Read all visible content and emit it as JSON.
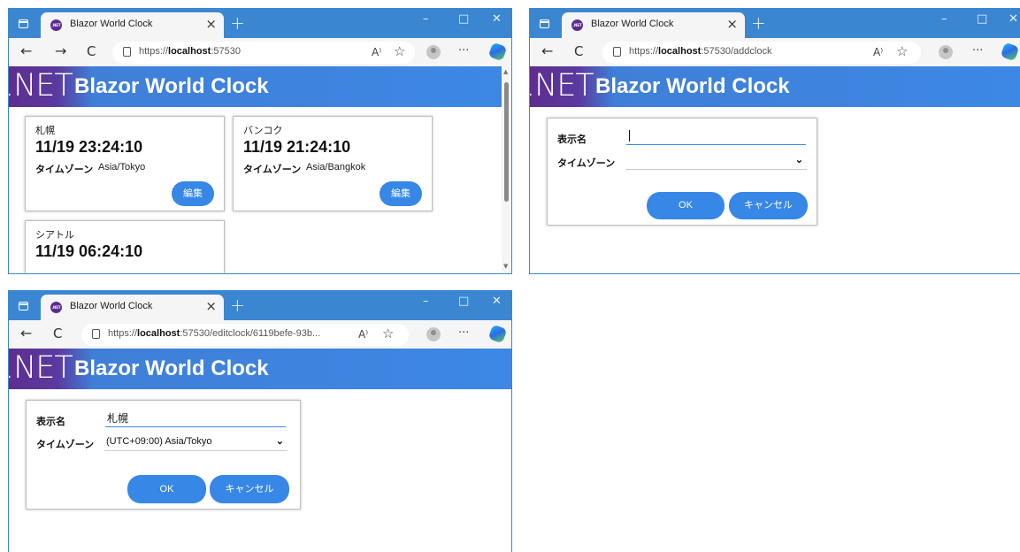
{
  "colors": {
    "accent": "#3d88e5",
    "brand_purple": "#5f2d90",
    "button": "#3687e6"
  },
  "browser": {
    "tab_title": "Blazor World Clock",
    "favicon_text": ".NET",
    "new_tab": "+",
    "close_tab": "×",
    "minimize": "–",
    "maximize": "□",
    "close_window": "✕",
    "back": "←",
    "forward": "→",
    "refresh": "C",
    "read_aloud": "A⁾",
    "favorite": "☆",
    "more": "···"
  },
  "app": {
    "logo_text": ".NET",
    "title": "Blazor World Clock"
  },
  "window1": {
    "url_prefix": "https://",
    "url_host": "localhost",
    "url_rest": ":57530",
    "clocks": [
      {
        "name": "札幌",
        "time": "11/19 23:24:10",
        "tz_label": "タイムゾーン",
        "tz": "Asia/Tokyo",
        "edit_label": "編集"
      },
      {
        "name": "バンコク",
        "time": "11/19 21:24:10",
        "tz_label": "タイムゾーン",
        "tz": "Asia/Bangkok",
        "edit_label": "編集"
      },
      {
        "name": "シアトル",
        "time": "11/19 06:24:10"
      }
    ]
  },
  "window2": {
    "url_prefix": "https://",
    "url_host": "localhost",
    "url_rest": ":57530/addclock",
    "form": {
      "name_label": "表示名",
      "name_value": "",
      "tz_label": "タイムゾーン",
      "tz_value": "",
      "ok_label": "OK",
      "cancel_label": "キャンセル"
    }
  },
  "window3": {
    "url_prefix": "https://",
    "url_host": "localhost",
    "url_rest": ":57530/editclock/6119befe-93b...",
    "form": {
      "name_label": "表示名",
      "name_value": "札幌",
      "tz_label": "タイムゾーン",
      "tz_value": "(UTC+09:00) Asia/Tokyo",
      "ok_label": "OK",
      "cancel_label": "キャンセル"
    }
  }
}
